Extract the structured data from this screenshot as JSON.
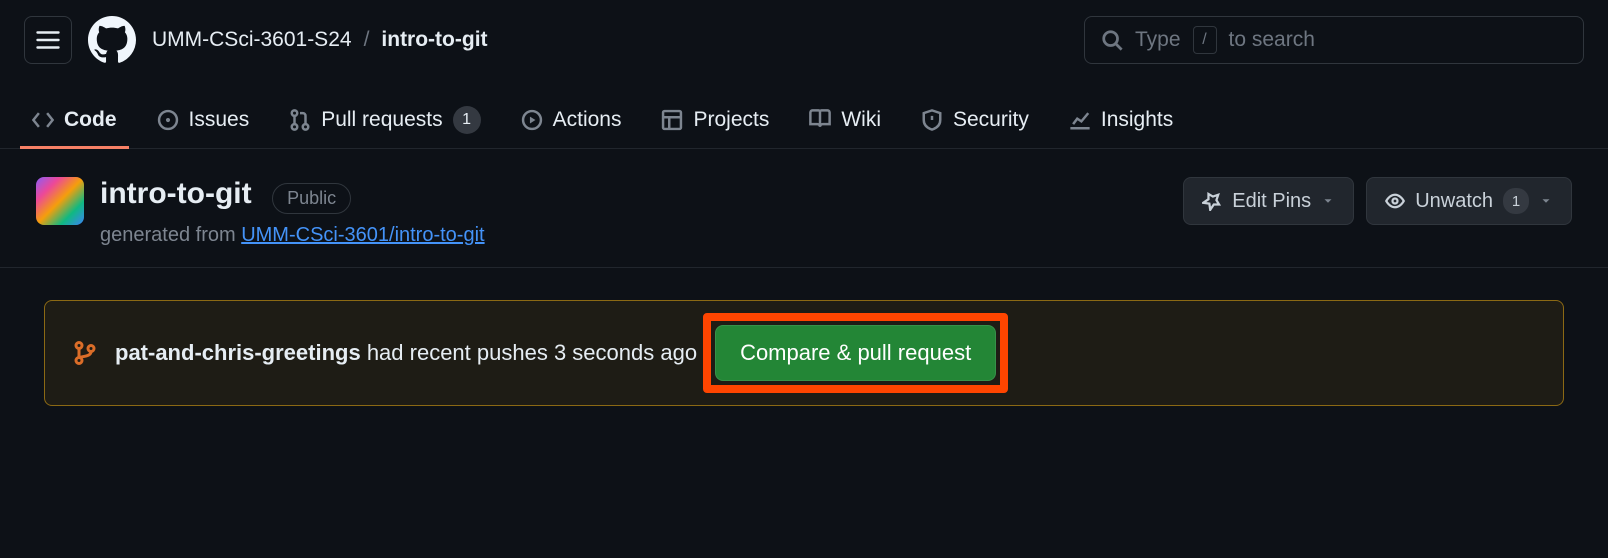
{
  "header": {
    "org": "UMM-CSci-3601-S24",
    "repo": "intro-to-git",
    "search_prefix": "Type",
    "search_suffix": "to search",
    "slash": "/"
  },
  "tabs": {
    "code": "Code",
    "issues": "Issues",
    "pulls": "Pull requests",
    "pulls_count": "1",
    "actions": "Actions",
    "projects": "Projects",
    "wiki": "Wiki",
    "security": "Security",
    "insights": "Insights"
  },
  "repo": {
    "name": "intro-to-git",
    "visibility": "Public",
    "gen_prefix": "generated from ",
    "gen_link": "UMM-CSci-3601/intro-to-git",
    "edit_pins": "Edit Pins",
    "unwatch": "Unwatch",
    "unwatch_count": "1"
  },
  "alert": {
    "branch": "pat-and-chris-greetings",
    "text": " had recent pushes 3 seconds ago",
    "button": "Compare & pull request"
  }
}
